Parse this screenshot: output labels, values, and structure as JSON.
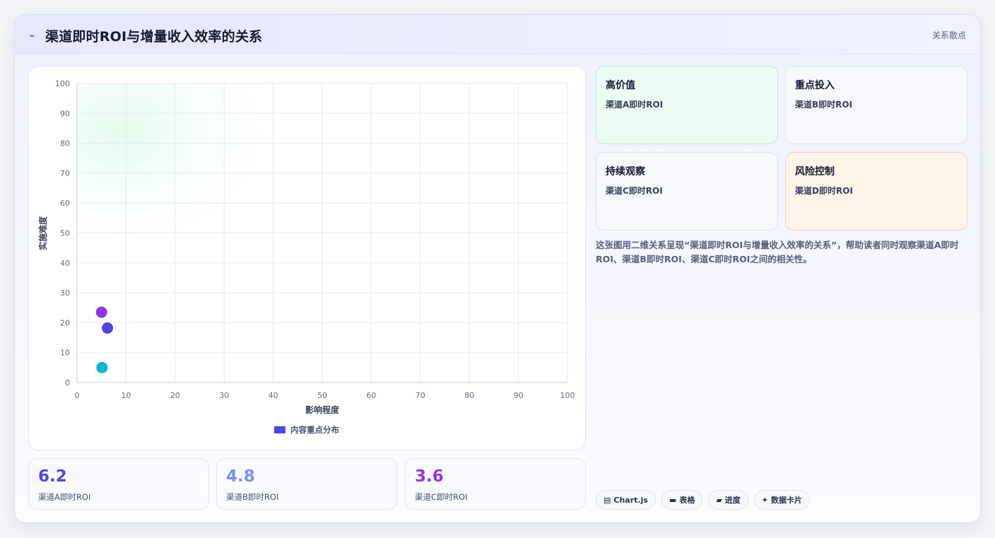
{
  "header": {
    "title": "渠道即时ROI与增量收入效率的关系",
    "tag": "关系散点",
    "icon": "bolt-icon"
  },
  "chart_data": {
    "type": "scatter",
    "xlabel": "影响程度",
    "ylabel": "实施难度",
    "xlim": [
      0,
      100
    ],
    "ylim": [
      0,
      100
    ],
    "x_ticks": [
      "0",
      "10",
      "20",
      "30",
      "40",
      "50",
      "60",
      "70",
      "80",
      "90",
      "100"
    ],
    "y_ticks": [
      "0",
      "10",
      "20",
      "30",
      "40",
      "50",
      "60",
      "70",
      "80",
      "90",
      "100"
    ],
    "grid": true,
    "legend": {
      "label": "内容重点分布",
      "color": "#4f46e5",
      "position": "bottom"
    },
    "series": [
      {
        "name": "内容重点分布",
        "points": [
          {
            "x": 5.0,
            "y": 23.5,
            "color": "#9333ea"
          },
          {
            "x": 6.2,
            "y": 18.2,
            "color": "#4f46e5"
          },
          {
            "x": 5.1,
            "y": 5.0,
            "color": "#06b6d4"
          }
        ]
      }
    ]
  },
  "kpis": [
    {
      "value": "6.2",
      "label": "渠道A即时ROI",
      "color": "#4f46e5"
    },
    {
      "value": "4.8",
      "label": "渠道B即时ROI",
      "color": "#818cf8"
    },
    {
      "value": "3.6",
      "label": "渠道C即时ROI",
      "color": "#9333ea"
    }
  ],
  "quadrants": [
    {
      "title": "高价值",
      "subtitle": "渠道A即时ROI",
      "bg": "#ecfbf4",
      "border": "#bfead2"
    },
    {
      "title": "重点投入",
      "subtitle": "渠道B即时ROI",
      "bg": "#f7f8fc",
      "border": "#dde2f1"
    },
    {
      "title": "持续观察",
      "subtitle": "渠道C即时ROI",
      "bg": "#f7f8fc",
      "border": "#dde2f1"
    },
    {
      "title": "风险控制",
      "subtitle": "渠道D即时ROI",
      "bg": "#fff4ea",
      "border": "#f3d3b6"
    }
  ],
  "description": "这张图用二维关系呈现“渠道即时ROI与增量收入效率的关系”，帮助读者同时观察渠道A即时ROI、渠道B即时ROI、渠道C即时ROI之间的相关性。",
  "chips": [
    {
      "icon": "▤",
      "icon_name": "chart-icon",
      "label": "Chart.js"
    },
    {
      "icon": "▬",
      "icon_name": "table-icon",
      "label": "表格"
    },
    {
      "icon": "▰",
      "icon_name": "progress-icon",
      "label": "进度"
    },
    {
      "icon": "✦",
      "icon_name": "sparkle-icon",
      "label": "数据卡片"
    }
  ]
}
